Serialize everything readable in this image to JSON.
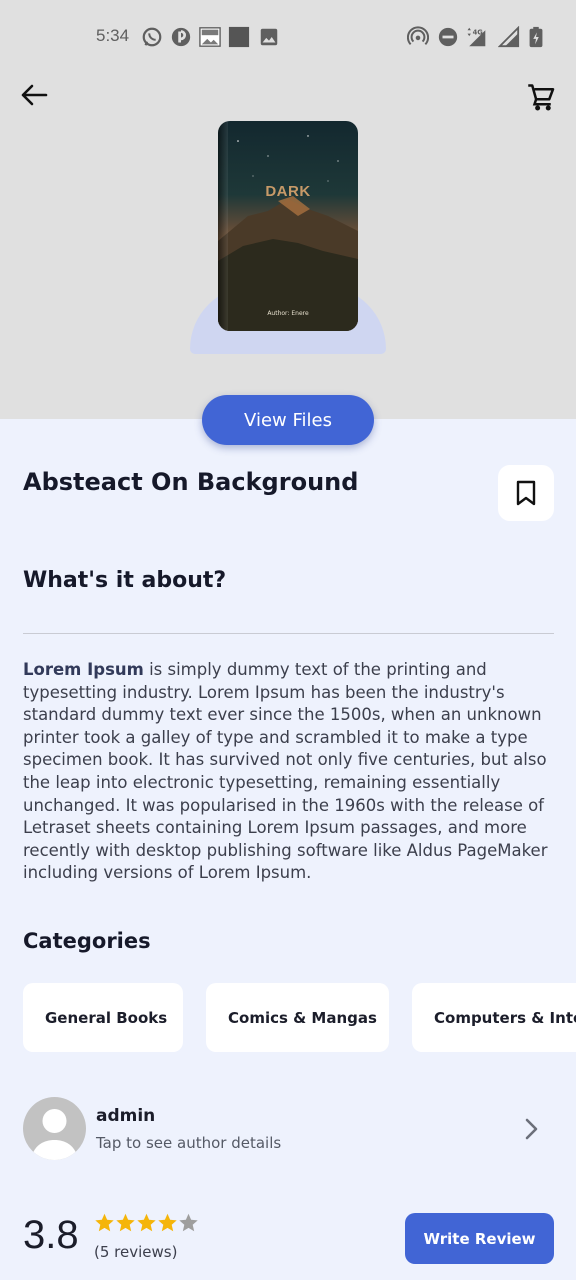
{
  "status_bar": {
    "time": "5:34",
    "left_icons": [
      "whatsapp-icon",
      "notification-app-icon",
      "image-thumbnail-icon",
      "square-app-icon",
      "gallery-icon"
    ],
    "right_icons": [
      "hotspot-icon",
      "dnd-icon",
      "network-4g-icon",
      "signal-icon",
      "battery-icon"
    ],
    "network_label": "4G"
  },
  "header": {
    "back_icon": "arrow-left-icon",
    "cart_icon": "cart-icon"
  },
  "book": {
    "cover_title": "DARK",
    "cover_author": "Author: Enere",
    "view_files_label": "View Files",
    "title": "Absteact On Background",
    "bookmark_icon": "bookmark-icon"
  },
  "about": {
    "heading": "What's it about?",
    "lead": "Lorem Ipsum",
    "body": " is simply dummy text of the printing and typesetting industry. Lorem Ipsum has been the industry's standard dummy text ever since the 1500s, when an unknown printer took a galley of type and scrambled it to make a type specimen book. It has survived not only five centuries, but also the leap into electronic typesetting, remaining essentially unchanged. It was popularised in the 1960s with the release of Letraset sheets containing Lorem Ipsum passages, and more recently with desktop publishing software like Aldus PageMaker including versions of Lorem Ipsum."
  },
  "categories": {
    "heading": "Categories",
    "items": [
      {
        "label": "General Books"
      },
      {
        "label": "Comics & Mangas"
      },
      {
        "label": "Computers & Internet"
      }
    ]
  },
  "author": {
    "name": "admin",
    "subtitle": "Tap to see author details"
  },
  "rating": {
    "value": "3.8",
    "stars_filled": 4,
    "stars_total": 5,
    "reviews_label": "(5 reviews)",
    "write_review_label": "Write Review"
  },
  "colors": {
    "accent": "#4165d5",
    "star_filled": "#f5b50a",
    "star_empty": "#9e9e9e",
    "background": "#eef2fd",
    "header_bg": "#e0e0e0"
  }
}
